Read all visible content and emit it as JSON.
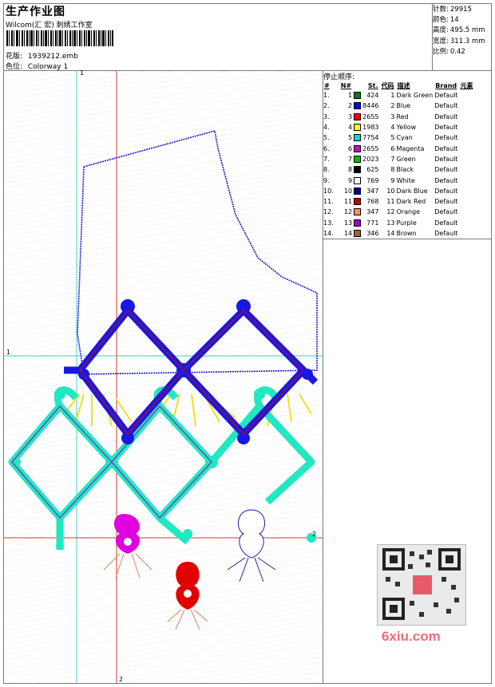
{
  "header": {
    "title": "生产作业图",
    "company": "Wilcom(汇 宏) 刺绣工作室",
    "design_label": "花版:",
    "design_value": "1939212.emb",
    "colorway_label": "色位:",
    "colorway_value": "Colorway 1"
  },
  "stats": [
    {
      "label": "针数:",
      "value": "29915"
    },
    {
      "label": "颜色:",
      "value": "14"
    },
    {
      "label": "高度:",
      "value": "495.5 mm"
    },
    {
      "label": "宽度:",
      "value": "311.3 mm"
    },
    {
      "label": "比例:",
      "value": "0.42"
    }
  ],
  "stop_sequence": {
    "title": "停止顺序:",
    "headers": [
      "#",
      "N#",
      "St.",
      "代码",
      "描述",
      "Brand",
      "元素"
    ],
    "rows": [
      {
        "idx": "1.",
        "n": "1",
        "color": "#008000",
        "st": "424",
        "code": "1",
        "desc": "Dark Green",
        "brand": "Default"
      },
      {
        "idx": "2.",
        "n": "2",
        "color": "#0000ff",
        "st": "8446",
        "code": "2",
        "desc": "Blue",
        "brand": "Default"
      },
      {
        "idx": "3.",
        "n": "3",
        "color": "#ff0000",
        "st": "2655",
        "code": "3",
        "desc": "Red",
        "brand": "Default"
      },
      {
        "idx": "4.",
        "n": "4",
        "color": "#ffff00",
        "st": "1983",
        "code": "4",
        "desc": "Yellow",
        "brand": "Default"
      },
      {
        "idx": "5.",
        "n": "5",
        "color": "#00e0c0",
        "st": "7754",
        "code": "5",
        "desc": "Cyan",
        "brand": "Default"
      },
      {
        "idx": "6.",
        "n": "6",
        "color": "#d000d0",
        "st": "2655",
        "code": "6",
        "desc": "Magenta",
        "brand": "Default"
      },
      {
        "idx": "7.",
        "n": "7",
        "color": "#00c000",
        "st": "2023",
        "code": "7",
        "desc": "Green",
        "brand": "Default"
      },
      {
        "idx": "8.",
        "n": "8",
        "color": "#000000",
        "st": "625",
        "code": "8",
        "desc": "Black",
        "brand": "Default"
      },
      {
        "idx": "9.",
        "n": "9",
        "color": "#ffffff",
        "st": "769",
        "code": "9",
        "desc": "White",
        "brand": "Default"
      },
      {
        "idx": "10.",
        "n": "10",
        "color": "#000090",
        "st": "347",
        "code": "10",
        "desc": "Dark Blue",
        "brand": "Default"
      },
      {
        "idx": "11.",
        "n": "11",
        "color": "#c00000",
        "st": "768",
        "code": "11",
        "desc": "Dark Red",
        "brand": "Default"
      },
      {
        "idx": "12.",
        "n": "12",
        "color": "#ff9060",
        "st": "347",
        "code": "12",
        "desc": "Orange",
        "brand": "Default"
      },
      {
        "idx": "13.",
        "n": "13",
        "color": "#a000c0",
        "st": "771",
        "code": "13",
        "desc": "Purple",
        "brand": "Default"
      },
      {
        "idx": "14.",
        "n": "14",
        "color": "#a0603a",
        "st": "346",
        "code": "14",
        "desc": "Brown",
        "brand": "Default"
      }
    ]
  },
  "canvas": {
    "axis_labels": [
      "1",
      "1",
      "2",
      "2"
    ]
  },
  "watermark": {
    "text": "6xiu.com"
  }
}
